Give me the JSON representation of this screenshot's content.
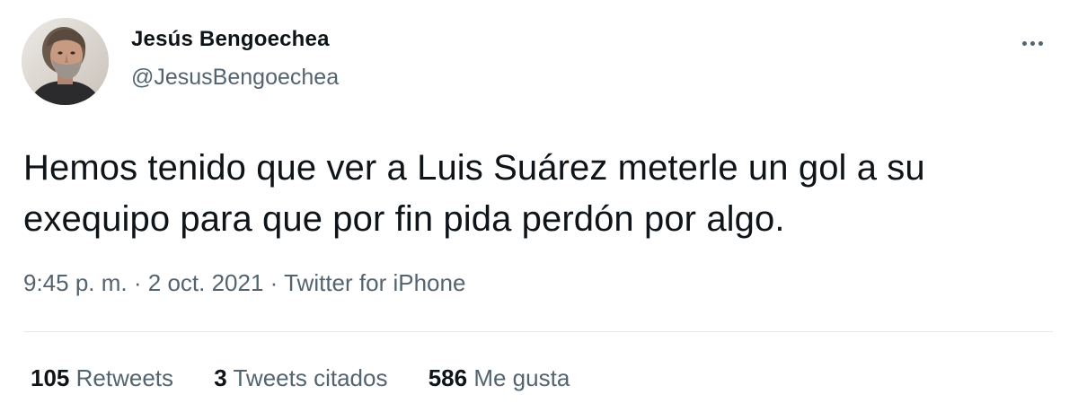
{
  "author": {
    "name": "Jesús Bengoechea",
    "handle": "@JesusBengoechea"
  },
  "tweet": {
    "lines": [
      "Hemos tenido que ver a Luis Suárez meterle un gol a su",
      "exequipo para que por fin pida perdón por algo."
    ]
  },
  "meta": {
    "time": "9:45 p. m.",
    "separator": "·",
    "date": "2 oct. 2021",
    "source": "Twitter for iPhone"
  },
  "stats": [
    {
      "count": "105",
      "label": "Retweets"
    },
    {
      "count": "3",
      "label": "Tweets citados"
    },
    {
      "count": "586",
      "label": "Me gusta"
    }
  ],
  "icons": {
    "more": "more-options-icon",
    "avatar": "profile-photo"
  },
  "colors": {
    "text": "#0f1419",
    "secondary": "#536471",
    "divider": "#e6e9eb"
  }
}
